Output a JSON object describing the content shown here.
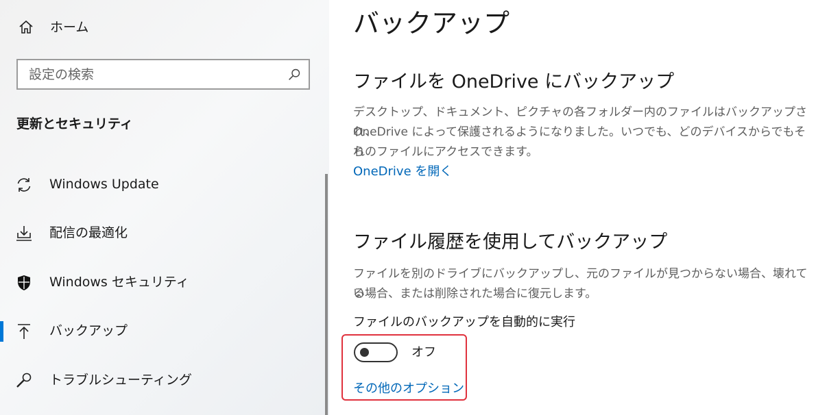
{
  "sidebar": {
    "home_label": "ホーム",
    "search_placeholder": "設定の検索",
    "section_title": "更新とセキュリティ",
    "items": [
      {
        "label": "Windows Update",
        "icon": "sync-icon"
      },
      {
        "label": "配信の最適化",
        "icon": "delivery-optimization-icon"
      },
      {
        "label": "Windows セキュリティ",
        "icon": "shield-icon"
      },
      {
        "label": "バックアップ",
        "icon": "backup-upload-icon",
        "selected": true
      },
      {
        "label": "トラブルシューティング",
        "icon": "wrench-icon"
      }
    ]
  },
  "main": {
    "title": "バックアップ",
    "onedrive": {
      "heading": "ファイルを OneDrive にバックアップ",
      "desc1": "デスクトップ、ドキュメント、ピクチャの各フォルダー内のファイルはバックアップされ、",
      "desc2": "OneDrive によって保護されるようになりました。いつでも、どのデバイスからでもそれ",
      "desc3": "らのファイルにアクセスできます。",
      "link": "OneDrive を開く"
    },
    "file_history": {
      "heading": "ファイル履歴を使用してバックアップ",
      "desc1": "ファイルを別のドライブにバックアップし、元のファイルが見つからない場合、壊れてい",
      "desc2": "る場合、または削除された場合に復元します。",
      "toggle_label": "ファイルのバックアップを自動的に実行",
      "toggle_state": "オフ",
      "more_options": "その他のオプション"
    }
  },
  "colors": {
    "accent": "#0078d7",
    "link": "#0067b8",
    "highlight": "#e0313d"
  }
}
